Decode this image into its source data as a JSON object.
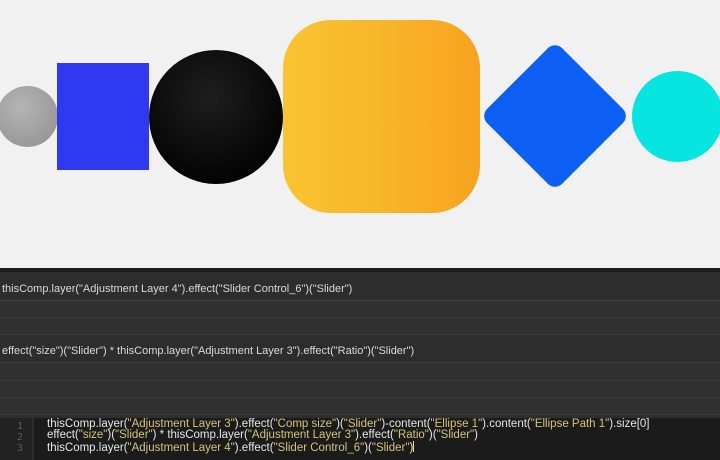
{
  "viewer": {
    "shapes": [
      {
        "name": "gray-circle",
        "color": "#9c9c9c"
      },
      {
        "name": "blue-rectangle",
        "color": "#2f3af0"
      },
      {
        "name": "black-circle",
        "color": "#000000"
      },
      {
        "name": "yellow-rounded-square",
        "color": "#f8b428"
      },
      {
        "name": "blue-diamond",
        "color": "#0d5ff3"
      },
      {
        "name": "cyan-circle",
        "color": "#07e5e0"
      }
    ]
  },
  "panel": {
    "expression_1": "thisComp.layer(\"Adjustment Layer 4\").effect(\"Slider Control_6\")(\"Slider\")",
    "expression_2": "effect(\"size\")(\"Slider\") * thisComp.layer(\"Adjustment Layer 3\").effect(\"Ratio\")(\"Slider\")"
  },
  "editor": {
    "line_numbers": [
      "1",
      "2",
      "3"
    ],
    "lines": [
      "thisComp.layer(\"Adjustment Layer 3\").effect(\"Comp size\")(\"Slider\")-content(\"Ellipse 1\").content(\"Ellipse Path 1\").size[0]",
      "effect(\"size\")(\"Slider\") * thisComp.layer(\"Adjustment Layer 3\").effect(\"Ratio\")(\"Slider\")",
      "thisComp.layer(\"Adjustment Layer 4\").effect(\"Slider Control_6\")(\"Slider\")"
    ],
    "colors": {
      "string": "#d6c27a",
      "text": "#e6e6e6",
      "caret": "#ffe14a"
    }
  }
}
